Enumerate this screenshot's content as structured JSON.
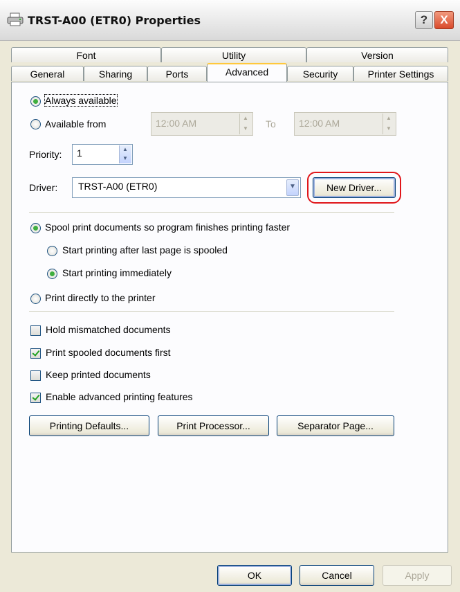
{
  "window": {
    "title": "TRST-A00 (ETR0) Properties",
    "help": "?",
    "close": "X"
  },
  "tabs_back": [
    "Font",
    "Utility",
    "Version"
  ],
  "tabs_front": [
    "General",
    "Sharing",
    "Ports",
    "Advanced",
    "Security",
    "Printer Settings"
  ],
  "availability": {
    "always": "Always available",
    "from": "Available from",
    "from_time": "12:00 AM",
    "to": "To",
    "to_time": "12:00 AM"
  },
  "priority": {
    "label": "Priority:",
    "value": "1"
  },
  "driver": {
    "label": "Driver:",
    "value": "TRST-A00 (ETR0)",
    "new_driver": "New Driver..."
  },
  "spool": {
    "spool_label": "Spool print documents so program finishes printing faster",
    "after_last": "Start printing after last page is spooled",
    "immediately": "Start printing immediately",
    "direct": "Print directly to the printer"
  },
  "options": {
    "hold": "Hold mismatched documents",
    "spooled_first": "Print spooled documents first",
    "keep": "Keep printed documents",
    "advanced": "Enable advanced printing features"
  },
  "buttons": {
    "defaults": "Printing Defaults...",
    "processor": "Print Processor...",
    "separator": "Separator Page...",
    "ok": "OK",
    "cancel": "Cancel",
    "apply": "Apply"
  }
}
